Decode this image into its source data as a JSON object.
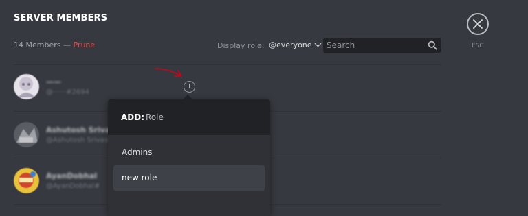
{
  "header": {
    "title": "SERVER MEMBERS",
    "member_count": "14 Members",
    "separator": " — ",
    "prune_label": "Prune",
    "display_role_label": "Display role:",
    "display_role_value": "@everyone",
    "search_placeholder": "Search",
    "esc_label": "ESC"
  },
  "members": [
    {
      "name": "——",
      "tag": "@······#2694",
      "avatar_color": "#c9c3d1"
    },
    {
      "name": "Ashutosh Srivastava",
      "tag": "@Ashutosh Srivastava#",
      "avatar_color": "#8d9096"
    },
    {
      "name": "AyanDobhal",
      "tag": "@AyanDobhal#",
      "avatar_color": "#d8b02a"
    }
  ],
  "add_role_popout": {
    "add_label": "ADD:",
    "input_placeholder": "Role",
    "roles": [
      {
        "label": "Admins",
        "selected": false
      },
      {
        "label": "new role",
        "selected": true
      }
    ]
  },
  "colors": {
    "background": "#36393f",
    "prune": "#f04747",
    "annotation_arrow": "#d0021b"
  },
  "icons": {
    "search": "search-icon",
    "close": "close-icon",
    "chevron": "chevron-down-icon",
    "add_role": "plus-circle-icon"
  }
}
